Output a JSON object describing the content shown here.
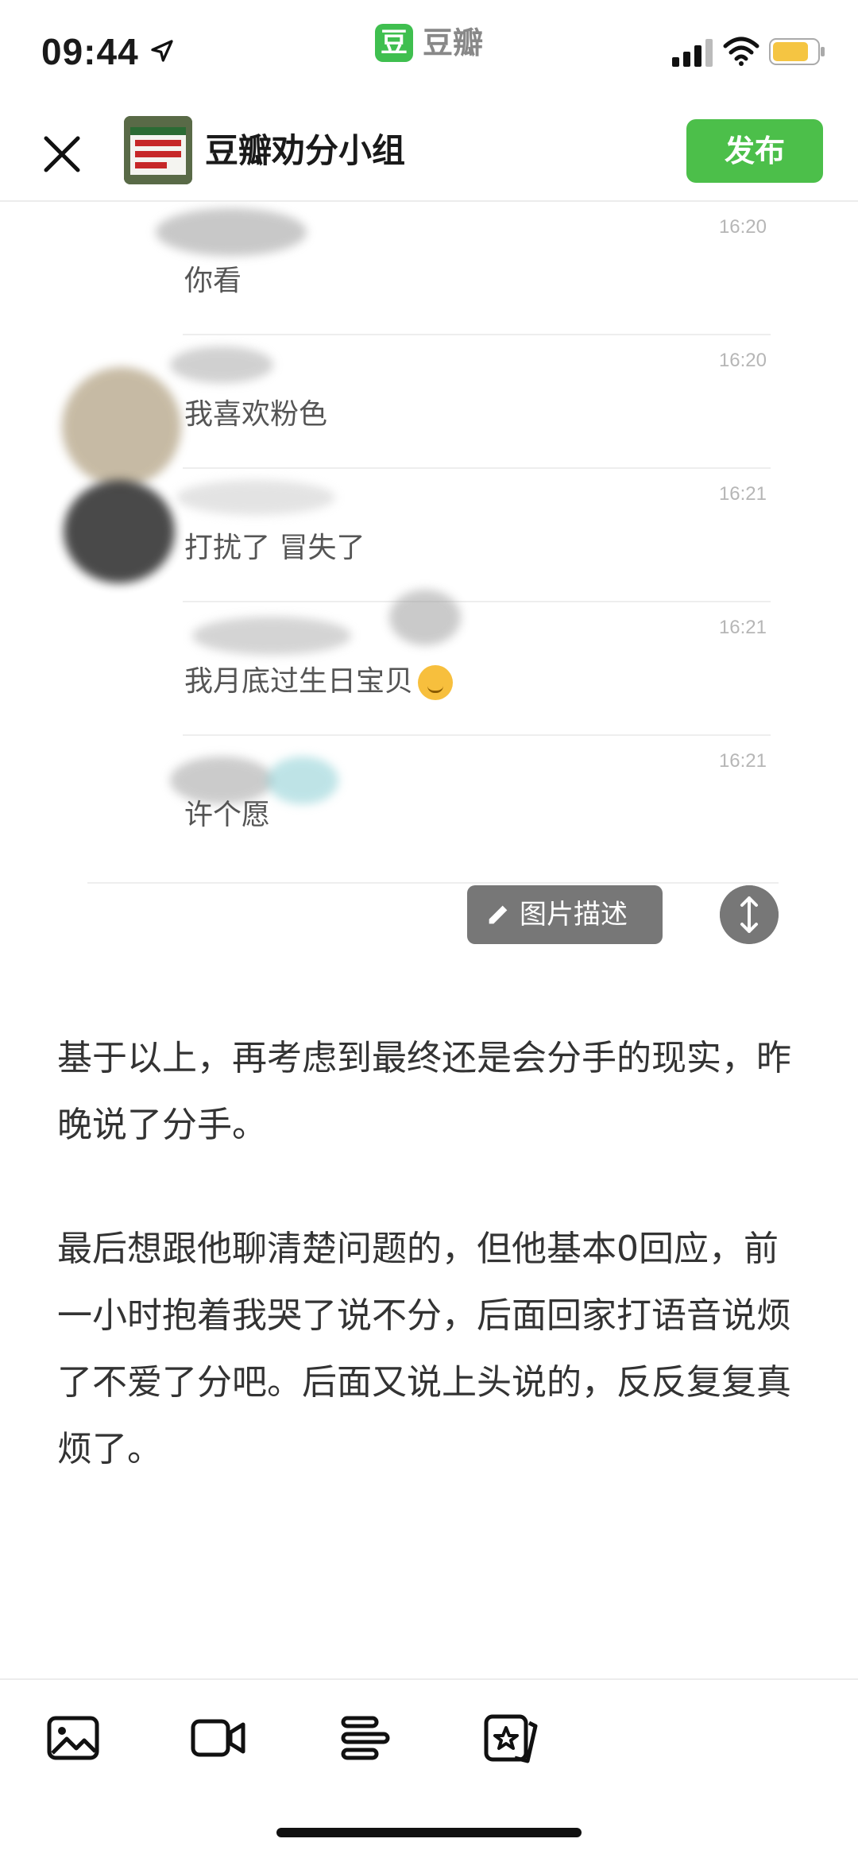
{
  "status_bar": {
    "time": "09:44",
    "app_name": "豆瓣",
    "app_logo_char": "豆"
  },
  "nav": {
    "group_name": "豆瓣劝分小组",
    "publish_label": "发布"
  },
  "chat_messages": [
    {
      "time": "16:20",
      "text": "你看"
    },
    {
      "time": "16:20",
      "text": "我喜欢粉色"
    },
    {
      "time": "16:21",
      "text": "打扰了 冒失了"
    },
    {
      "time": "16:21",
      "text": "我月底过生日宝贝"
    },
    {
      "time": "16:21",
      "text": "许个愿"
    }
  ],
  "image_tools": {
    "describe_label": "图片描述"
  },
  "article": {
    "paragraphs": [
      "基于以上，再考虑到最终还是会分手的现实，昨晚说了分手。",
      "最后想跟他聊清楚问题的，但他基本0回应，前一小时抱着我哭了说不分，后面回家打语音说烦了不爱了分吧。后面又说上头说的，反反复复真烦了。"
    ]
  },
  "colors": {
    "accent": "#4cbf4a",
    "overlay_button": "#777777",
    "battery": "#f5c542"
  }
}
